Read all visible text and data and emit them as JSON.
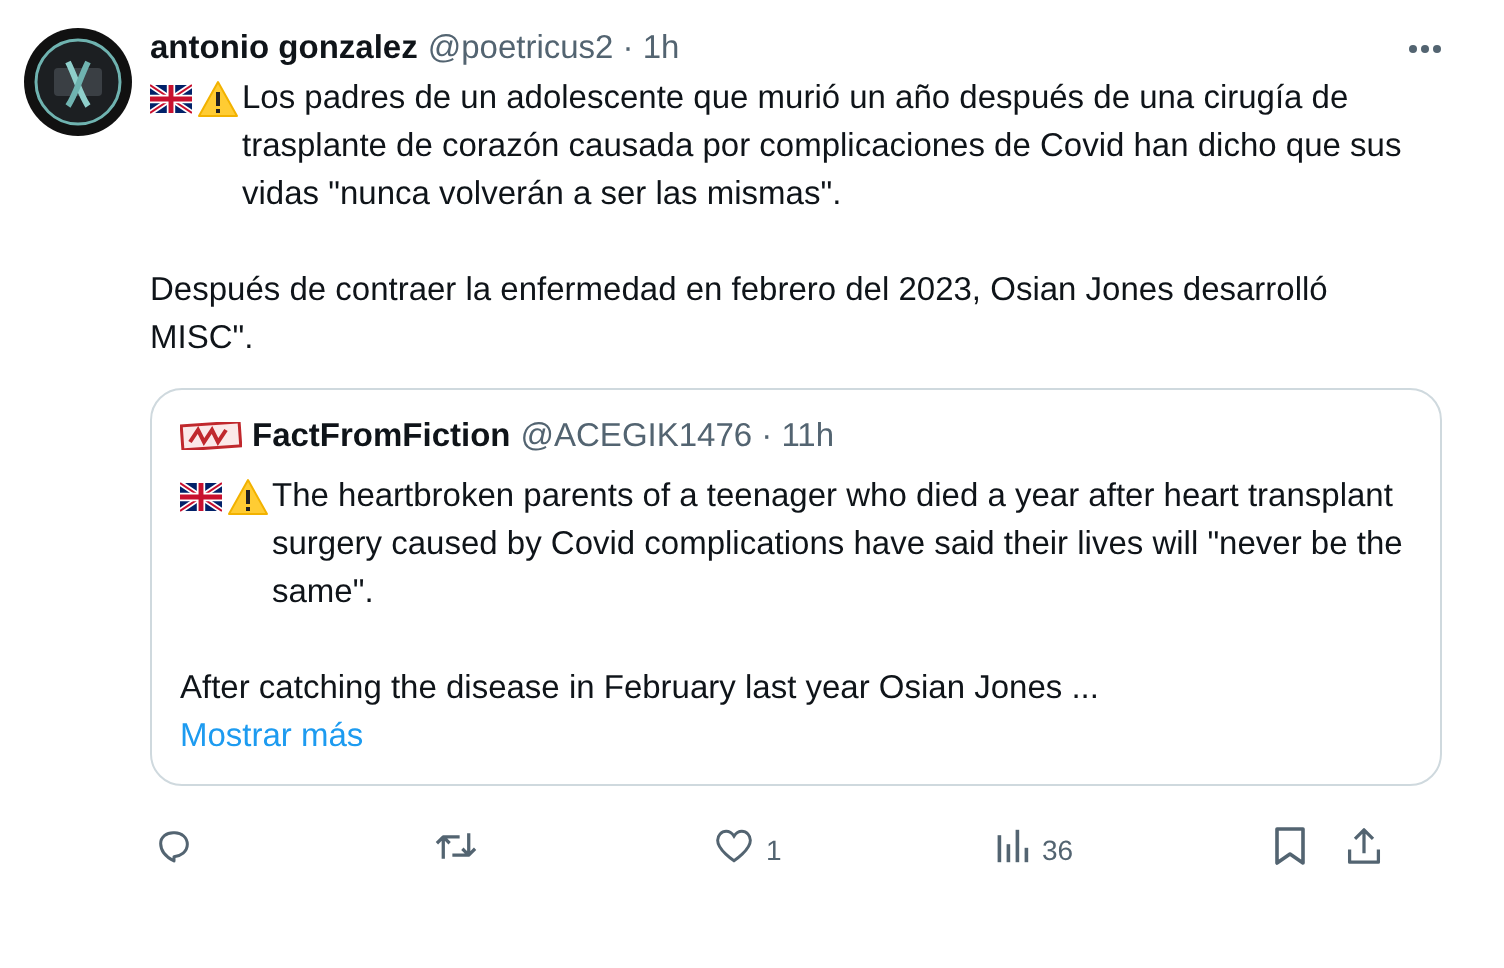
{
  "post": {
    "name": "antonio gonzalez",
    "meta": "@poetricus2 · 1h",
    "paragraphs": [
      {
        "icons": [
          {
            "kind": "flag"
          },
          {
            "kind": "warning"
          }
        ],
        "text": "Los padres de un adolescente que murió un año después de una cirugía de trasplante de corazón causada por complicaciones de Covid han dicho que sus vidas \"nunca volverán a ser las mismas\"."
      },
      {
        "text": "Después de contraer la enfermedad en febrero del 2023, Osian Jones desarrolló MISC\"."
      }
    ]
  },
  "quote": {
    "name": "FactFromFiction",
    "meta": "@ACEGIK1476 · 11h",
    "paragraphs": [
      {
        "icons": [
          {
            "kind": "flag"
          },
          {
            "kind": "warning"
          }
        ],
        "text": "The heartbroken parents of a teenager who died a year after heart transplant surgery caused by Covid complications have said their lives will \"never be the same\"."
      },
      {
        "text": "After catching the disease in February last year Osian Jones ..."
      }
    ],
    "show_more": "Mostrar más"
  },
  "actions": [
    {
      "kind": "reply"
    },
    {
      "kind": "repost"
    },
    {
      "kind": "like",
      "count": "1"
    },
    {
      "kind": "views",
      "count": "36"
    },
    {
      "kind": "bookmark"
    },
    {
      "kind": "share"
    }
  ]
}
